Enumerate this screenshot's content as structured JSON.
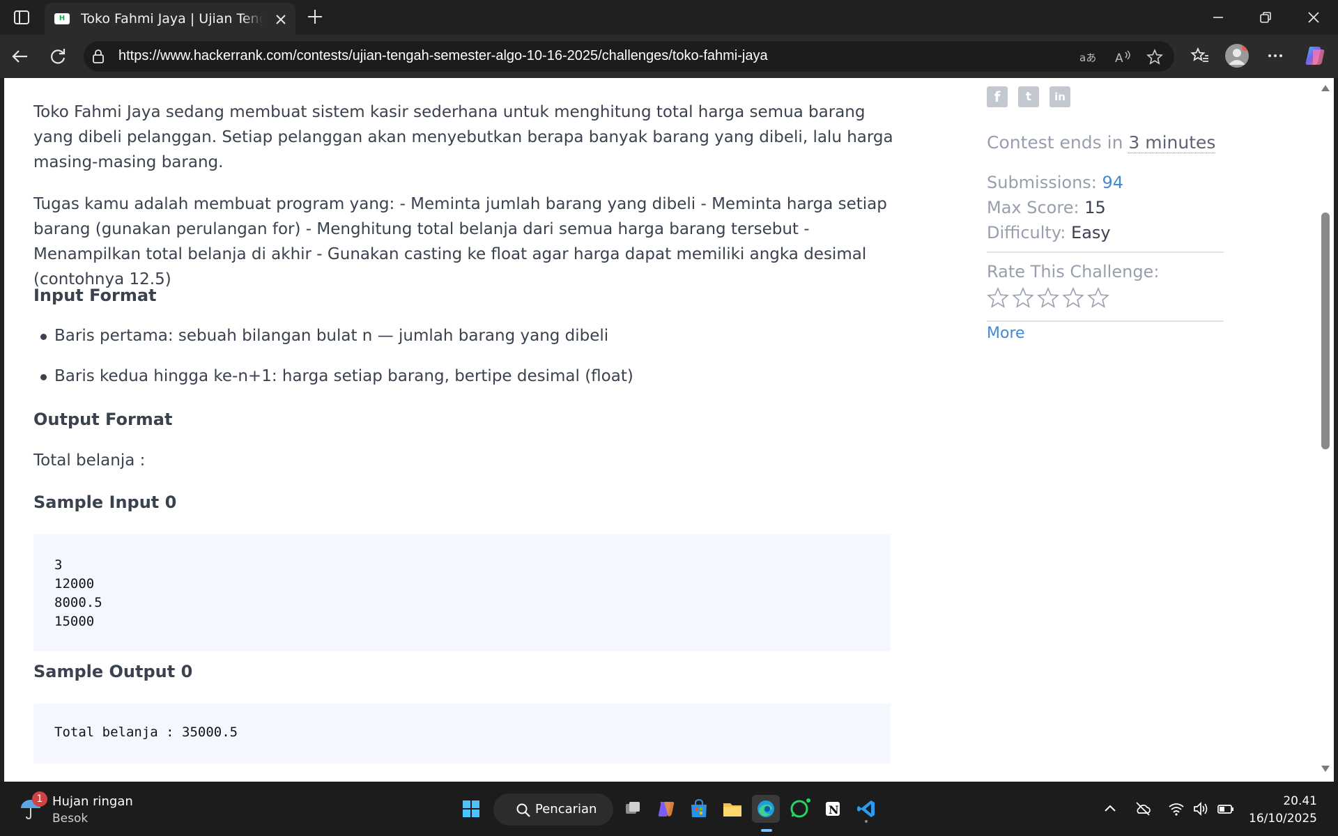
{
  "browser": {
    "tab_title": "Toko Fahmi Jaya | Ujian Tengah Semester",
    "favicon_text": "H",
    "url": "https://www.hackerrank.com/contests/ujian-tengah-semester-algo-10-16-2025/challenges/toko-fahmi-jaya",
    "icons": [
      "sidebar-icon",
      "close-icon",
      "plus-icon",
      "minimize-icon",
      "restore-icon",
      "back-icon",
      "refresh-icon",
      "lock-icon",
      "translate-icon",
      "read-aloud-icon",
      "star-icon",
      "favorites-icon",
      "profile-icon",
      "more-icon",
      "copilot-icon"
    ]
  },
  "problem": {
    "intro": "Toko Fahmi Jaya sedang membuat sistem kasir sederhana untuk menghitung total harga semua barang yang dibeli pelanggan. Setiap pelanggan akan menyebutkan berapa banyak barang yang dibeli, lalu harga masing-masing barang.",
    "task": "Tugas kamu adalah membuat program yang: - Meminta jumlah barang yang dibeli - Meminta harga setiap barang (gunakan perulangan for) - Menghitung total belanja dari semua harga barang tersebut - Menampilkan total belanja di akhir - Gunakan casting ke float agar harga dapat memiliki angka desimal (contohnya 12.5)",
    "input_format_heading": "Input Format",
    "input_format_items": [
      "Baris pertama: sebuah bilangan bulat n — jumlah barang yang dibeli",
      "Baris kedua hingga ke-n+1: harga setiap barang, bertipe desimal (float)"
    ],
    "output_format_heading": "Output Format",
    "output_format_text": "Total belanja :",
    "sample_input_heading": "Sample Input 0",
    "sample_input": "3\n12000\n8000.5\n15000",
    "sample_output_heading": "Sample Output 0",
    "sample_output": "Total belanja : 35000.5"
  },
  "sidebar": {
    "social": [
      "f",
      "t",
      "in"
    ],
    "contest_ends_prefix": "Contest ends in",
    "contest_ends_value": "3 minutes",
    "submissions_label": "Submissions:",
    "submissions_value": "94",
    "max_score_label": "Max Score:",
    "max_score_value": "15",
    "difficulty_label": "Difficulty:",
    "difficulty_value": "Easy",
    "rate_label": "Rate This Challenge:",
    "rating_stars_total": 5,
    "rating_stars_filled": 0,
    "more_link": "More"
  },
  "taskbar": {
    "weather_badge": "1",
    "weather_title": "Hujan ringan",
    "weather_sub": "Besok",
    "search_label": "Pencarian",
    "time": "20.41",
    "date": "16/10/2025"
  },
  "colors": {
    "text": "#39424e",
    "muted": "#979faf",
    "link": "#4388d4",
    "code_bg": "#f4f7fd"
  }
}
